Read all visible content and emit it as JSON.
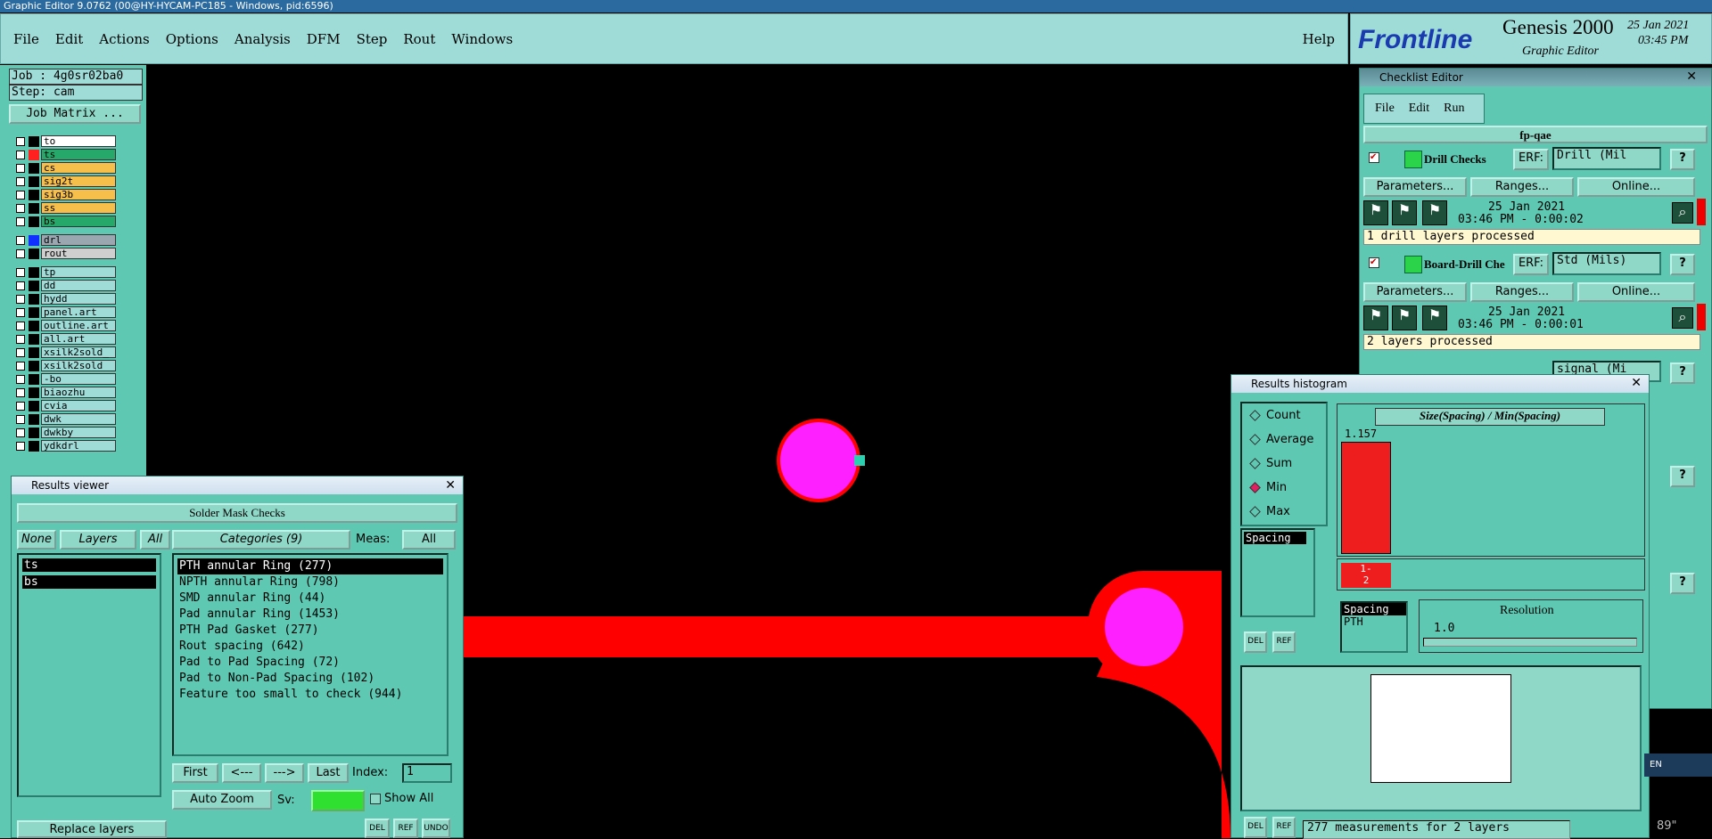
{
  "window": {
    "title": "Graphic Editor 9.0762 (00@HY-HYCAM-PC185 - Windows, pid:6596)"
  },
  "menu": {
    "items": [
      "File",
      "Edit",
      "Actions",
      "Options",
      "Analysis",
      "DFM",
      "Step",
      "Rout",
      "Windows"
    ],
    "help": "Help"
  },
  "brand": {
    "logo": "Frontline",
    "product": "Genesis 2000",
    "subtitle": "Graphic Editor",
    "date": "25 Jan 2021",
    "time": "03:45 PM"
  },
  "job": {
    "job": "Job : 4g0sr02ba0",
    "step": "Step: cam",
    "matrix": "Job Matrix ..."
  },
  "layers_board": [
    {
      "name": "to",
      "color": "#000000",
      "bg": "#ffffff"
    },
    {
      "name": "ts",
      "color": "#ff2020",
      "bg": "#26a86a"
    },
    {
      "name": "cs",
      "color": "#000000",
      "bg": "#f6be4a"
    },
    {
      "name": "sig2t",
      "color": "#000000",
      "bg": "#f6be4a"
    },
    {
      "name": "sig3b",
      "color": "#000000",
      "bg": "#f6be4a"
    },
    {
      "name": "ss",
      "color": "#000000",
      "bg": "#f6be4a"
    },
    {
      "name": "bs",
      "color": "#000000",
      "bg": "#26a86a"
    }
  ],
  "layers_drill": [
    {
      "name": "drl",
      "color": "#1030ff",
      "bg": "#9aa6b0"
    },
    {
      "name": "rout",
      "color": "#000000",
      "bg": "#cfcfcf"
    }
  ],
  "layers_misc": [
    "tp",
    "dd",
    "hydd",
    "panel.art",
    "outline.art",
    "all.art",
    "xsilk2sold_",
    "xsilk2sold",
    "-bo",
    "biaozhu",
    "cvia",
    "dwk",
    "dwkby",
    "ydkdrl"
  ],
  "results_viewer": {
    "title": "Results viewer",
    "header": "Solder Mask Checks",
    "none": "None",
    "layers": "Layers",
    "all": "All",
    "layer_list": [
      "ts",
      "bs"
    ],
    "categories_label": "Categories (9)",
    "meas_label": "Meas:",
    "meas_value": "All",
    "categories": [
      "PTH annular Ring (277)",
      "NPTH annular Ring (798)",
      "SMD annular Ring (44)",
      "Pad annular Ring (1453)",
      "PTH Pad Gasket (277)",
      "Rout spacing (642)",
      "Pad to Pad Spacing (72)",
      "Pad to Non-Pad Spacing (102)",
      "Feature too small to check (944)"
    ],
    "first": "First",
    "prev": "<---",
    "next": "--->",
    "last": "Last",
    "index_label": "Index:",
    "index_value": "1",
    "zoom": "Auto Zoom",
    "sv": "Sv:",
    "show_all": "Show All",
    "replace": "Replace layers",
    "del": "DEL",
    "ref": "REF",
    "undo": "UNDO"
  },
  "checklist": {
    "title": "Checklist Editor",
    "menu": [
      "File",
      "Edit",
      "Run"
    ],
    "name": "fp-qae",
    "checks": [
      {
        "name": "Drill Checks",
        "erf_label": "ERF:",
        "erf": "Drill (Mil",
        "date": "25 Jan 2021",
        "time": "03:46 PM - 0:00:02",
        "status": "1 drill layers processed"
      },
      {
        "name": "Board-Drill Che",
        "erf_label": "ERF:",
        "erf": "Std (Mils)",
        "date": "25 Jan 2021",
        "time": "03:46 PM - 0:00:01",
        "status": "2 layers processed"
      }
    ],
    "parameters": "Parameters...",
    "ranges": "Ranges...",
    "online": "Online...",
    "third_erf": "signal (Mi"
  },
  "histogram": {
    "title": "Results histogram",
    "options": [
      "Count",
      "Average",
      "Sum",
      "Min",
      "Max"
    ],
    "selected": "Min",
    "field": "Spacing",
    "heading": "Size(Spacing) / Min(Spacing)",
    "bar_value": "1.157",
    "bin_label": "1-\n2",
    "list": [
      "Spacing",
      "PTH"
    ],
    "resolution_label": "Resolution",
    "resolution": "1.0",
    "status": "277 measurements for 2 layers",
    "del": "DEL",
    "ref": "REF"
  },
  "tray": {
    "lang": "EN",
    "coord": "89\""
  }
}
